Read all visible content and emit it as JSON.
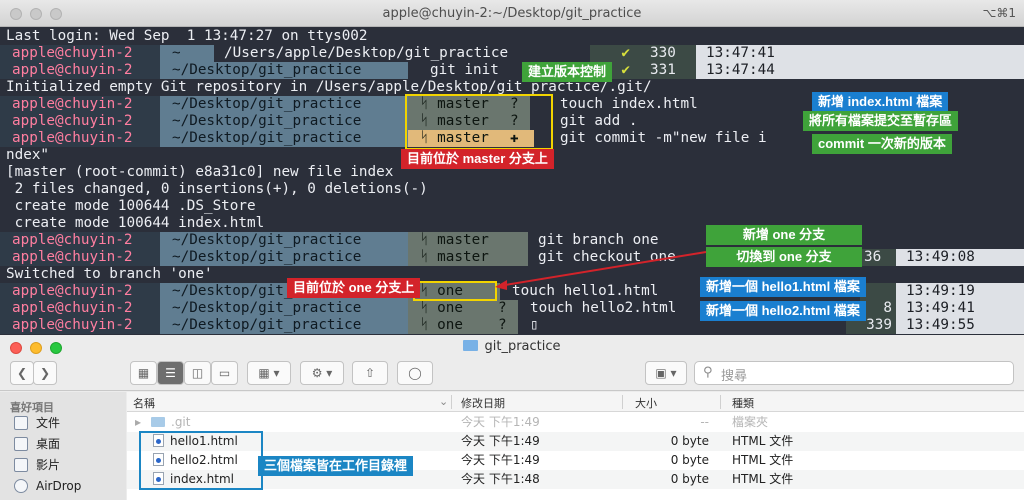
{
  "terminal": {
    "title": "apple@chuyin-2:~/Desktop/git_practice",
    "shortcut": "⌥⌘1",
    "login_line": "Last login: Wed Sep  1 13:47:27 on ttys002",
    "prompt_user": "apple@chuyin-2",
    "home_glyph": "~",
    "path_full": "/Users/apple/Desktop/git_practice",
    "path": "~/Desktop/git_practice",
    "git_init": "git init",
    "init_out_a": "Initialized empty Git repository in /Users/apple/Desktop/git_practice/.git/",
    "touch_index": "touch index.html",
    "git_add": "git add .",
    "git_commit": "git commit -m\"new file i",
    "commit_wrap": "ndex\"",
    "commit_out": "[master (root-commit) e8a31c0] new file index",
    "files_changed": " 2 files changed, 0 insertions(+), 0 deletions(-)",
    "create_ds": " create mode 100644 .DS_Store",
    "create_index": " create mode 100644 index.html",
    "git_branch": "git branch one",
    "git_checkout": "git checkout one",
    "switched": "Switched to branch 'one'",
    "touch_hello1": "touch hello1.html",
    "touch_hello2": "touch hello2.html",
    "cursor": "▯",
    "branch_master": "ᛋ master",
    "branch_one": "ᛋ one",
    "branch_q": "?",
    "branch_plus": "✚",
    "check": "✔",
    "status": [
      {
        "num": "330",
        "time": "13:47:41"
      },
      {
        "num": "331",
        "time": "13:47:44"
      },
      {
        "num": "36",
        "time": "13:49:08"
      },
      {
        "num": "",
        "time": "13:49:19"
      },
      {
        "num": "8",
        "time": "13:49:41"
      },
      {
        "num": "339",
        "time": "13:49:55"
      }
    ],
    "annotations": {
      "init_repo": "建立版本控制",
      "new_index": "新增 index.html 檔案",
      "add_all": "將所有檔案提交至暫存區",
      "commit_new": "commit 一次新的版本",
      "on_master": "目前位於 master 分支上",
      "new_branch_one": "新增 one 分支",
      "switch_one": "切換到 one 分支",
      "on_one": "目前位於 one 分支上",
      "new_hello1": "新增一個 hello1.html 檔案",
      "new_hello2": "新增一個 hello2.html 檔案"
    }
  },
  "finder": {
    "title": "git_practice",
    "search_placeholder": "搜尋",
    "sidebar": {
      "header": "喜好項目",
      "items": [
        "文件",
        "桌面",
        "影片",
        "AirDrop"
      ]
    },
    "columns": {
      "name": "名稱",
      "date": "修改日期",
      "size": "大小",
      "kind": "種類"
    },
    "rows": [
      {
        "name": ".git",
        "date": "今天 下午1:49",
        "size": "--",
        "kind": "檔案夾"
      },
      {
        "name": "hello1.html",
        "date": "今天 下午1:49",
        "size": "0 byte",
        "kind": "HTML 文件"
      },
      {
        "name": "hello2.html",
        "date": "今天 下午1:49",
        "size": "0 byte",
        "kind": "HTML 文件"
      },
      {
        "name": "index.html",
        "date": "今天 下午1:48",
        "size": "0 byte",
        "kind": "HTML 文件"
      }
    ],
    "annotation": "三個檔案皆在工作目錄裡"
  }
}
